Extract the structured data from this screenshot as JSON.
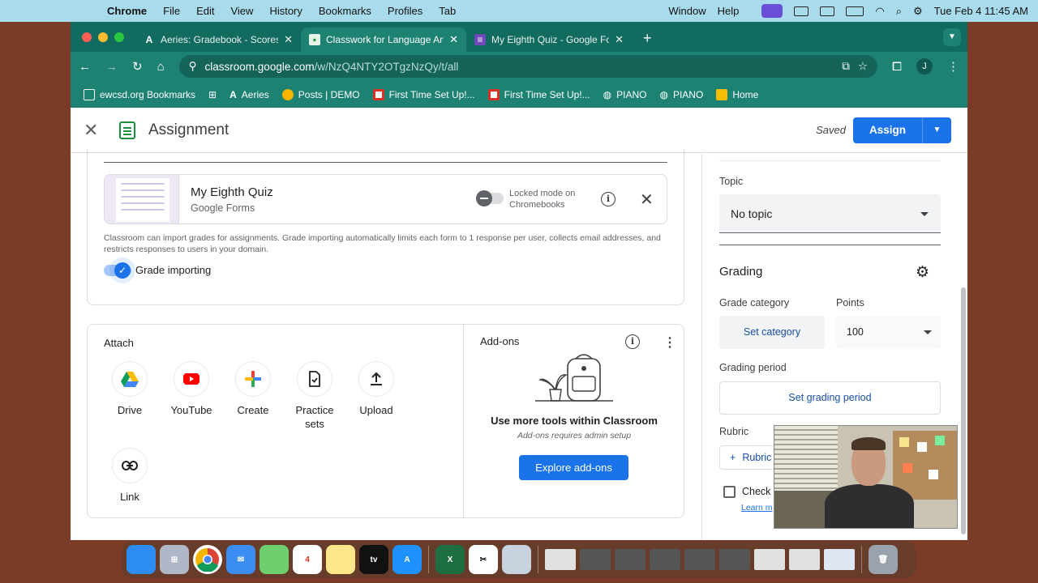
{
  "menubar": {
    "app": "Chrome",
    "items": [
      "File",
      "Edit",
      "View",
      "History",
      "Bookmarks",
      "Profiles",
      "Tab"
    ],
    "right_items": [
      "Window",
      "Help"
    ],
    "datetime": "Tue Feb 4  11:45 AM"
  },
  "tabs": [
    {
      "title": "Aeries: Gradebook - Scores b",
      "icon": "aeries-icon"
    },
    {
      "title": "Classwork for Language Arts",
      "icon": "classroom-icon",
      "active": true
    },
    {
      "title": "My Eighth Quiz - Google Form",
      "icon": "forms-icon"
    }
  ],
  "toolbar": {
    "url_host": "classroom.google.com",
    "url_path": "/w/NzQ4NTY2OTgzNzQy/t/all",
    "profile_initial": "J"
  },
  "bookmarks": [
    {
      "label": "ewcsd.org Bookmarks",
      "icon": "folder-icon"
    },
    {
      "label": "",
      "icon": "apps-grid-icon"
    },
    {
      "label": "Aeries",
      "icon": "aeries-icon"
    },
    {
      "label": "Posts | DEMO",
      "icon": "posts-icon"
    },
    {
      "label": "First Time Set Up!...",
      "icon": "flag-icon"
    },
    {
      "label": "First Time Set Up!...",
      "icon": "flag-icon"
    },
    {
      "label": "PIANO",
      "icon": "globe-icon"
    },
    {
      "label": "PIANO",
      "icon": "globe-icon"
    },
    {
      "label": "Home",
      "icon": "home-icon"
    }
  ],
  "header": {
    "title": "Assignment",
    "saved": "Saved",
    "assign_label": "Assign"
  },
  "quiz": {
    "name": "My Eighth Quiz",
    "source": "Google Forms",
    "locked_mode": "Locked mode on Chromebooks",
    "import_note": "Classroom can import grades for assignments. Grade importing automatically limits each form to 1 response per user, collects email addresses, and restricts responses to users in your domain.",
    "grade_importing": "Grade importing"
  },
  "attach": {
    "title": "Attach",
    "items": [
      {
        "label": "Drive",
        "icon": "drive-icon"
      },
      {
        "label": "YouTube",
        "icon": "youtube-icon"
      },
      {
        "label": "Create",
        "icon": "create-plus-icon"
      },
      {
        "label": "Practice sets",
        "icon": "practice-sets-icon"
      },
      {
        "label": "Upload",
        "icon": "upload-icon"
      },
      {
        "label": "Link",
        "icon": "link-icon"
      }
    ]
  },
  "addons": {
    "title": "Add-ons",
    "heading": "Use more tools within Classroom",
    "sub": "Add-ons requires admin setup",
    "button": "Explore add-ons"
  },
  "sidebar": {
    "topic_label": "Topic",
    "topic_value": "No topic",
    "grading_title": "Grading",
    "grade_category_label": "Grade category",
    "set_category": "Set category",
    "points_label": "Points",
    "points_value": "100",
    "grading_period_label": "Grading period",
    "set_grading_period": "Set grading period",
    "rubric_label": "Rubric",
    "rubric_button": "Rubric",
    "check_label": "Check p",
    "learn_more": "Learn m"
  },
  "colors": {
    "chrome_frame": "#116b5f",
    "chrome_toolbar": "#1d8272",
    "accent_blue": "#1a73e8",
    "menubar": "#a8dcec"
  }
}
